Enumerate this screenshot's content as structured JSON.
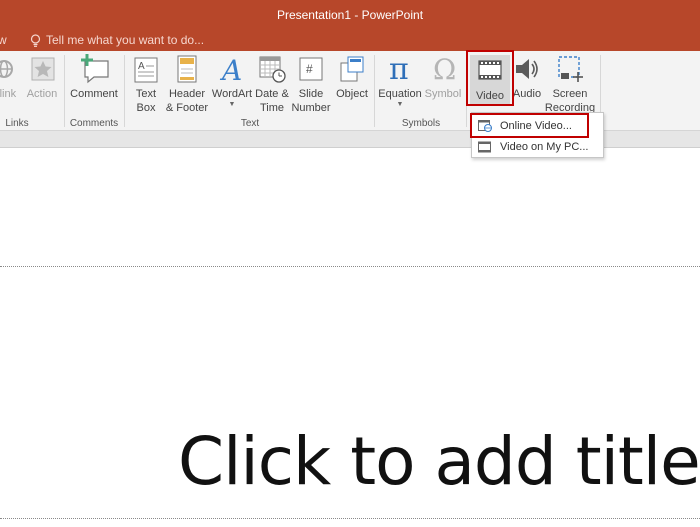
{
  "window": {
    "title": "Presentation1 - PowerPoint"
  },
  "tabs": {
    "partial_tab": "w",
    "tell_me": "Tell me what you want to do..."
  },
  "ribbon": {
    "links": {
      "hyperlink": "rlink",
      "action": "Action",
      "group": "Links"
    },
    "comments": {
      "comment": "Comment",
      "group": "Comments"
    },
    "text": {
      "textbox": [
        "Text",
        "Box"
      ],
      "header_footer": [
        "Header",
        "& Footer"
      ],
      "wordart": "WordArt",
      "date_time": [
        "Date &",
        "Time"
      ],
      "slide_number": [
        "Slide",
        "Number"
      ],
      "object": "Object",
      "group": "Text"
    },
    "symbols": {
      "equation": "Equation",
      "symbol": "Symbol",
      "group": "Symbols"
    },
    "media": {
      "video": "Video",
      "audio": "Audio",
      "screen_recording": [
        "Screen",
        "Recording"
      ]
    }
  },
  "video_menu": {
    "items": [
      "Online Video...",
      "Video on My PC..."
    ]
  },
  "slide": {
    "title_placeholder": "Click to add title"
  },
  "colors": {
    "accent": "#b7472a",
    "highlight": "#c00000"
  }
}
